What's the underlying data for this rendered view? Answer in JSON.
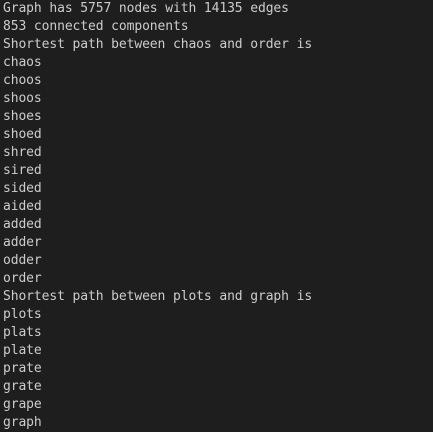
{
  "terminal": {
    "lines": [
      "Graph has 5757 nodes with 14135 edges",
      "853 connected components",
      "Shortest path between chaos and order is",
      "chaos",
      "choos",
      "shoos",
      "shoes",
      "shoed",
      "shred",
      "sired",
      "sided",
      "aided",
      "added",
      "adder",
      "odder",
      "order",
      "Shortest path between plots and graph is",
      "plots",
      "plats",
      "plate",
      "prate",
      "grate",
      "grape",
      "graph"
    ]
  }
}
